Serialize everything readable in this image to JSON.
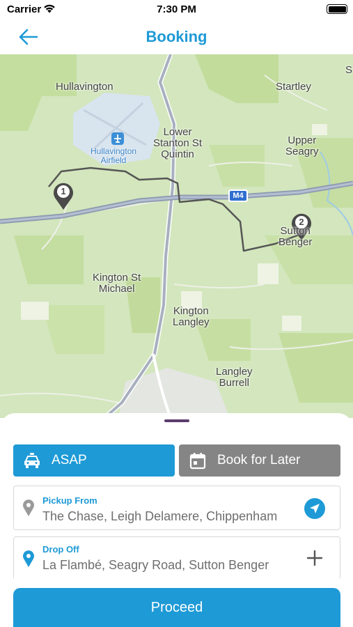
{
  "status_bar": {
    "carrier": "Carrier",
    "time": "7:30 PM"
  },
  "header": {
    "title": "Booking",
    "back_icon": "arrow-left-icon"
  },
  "map": {
    "labels": {
      "hullavington": "Hullavington",
      "startley": "Startley",
      "lower_stanton": "Lower\nStanton St\nQuintin",
      "airfield": "Hullavington\nAirfield",
      "upper_seagry": "Upper\nSeagry",
      "motorway": "M4",
      "sutton_benger": "Sutton\nBenger",
      "kington_st_michael": "Kington St\nMichael",
      "kington_langley": "Kington\nLangley",
      "langley_burrell": "Langley\nBurrell",
      "edge_s": "S"
    },
    "markers": {
      "start": "1",
      "end": "2"
    },
    "colors": {
      "route": "#555555",
      "marker": "#4a4a4a",
      "road": "#9aa5b5"
    }
  },
  "booking": {
    "asap_label": "ASAP",
    "later_label": "Book for Later",
    "pickup": {
      "label": "Pickup From",
      "value": "The Chase, Leigh Delamere, Chippenham"
    },
    "dropoff": {
      "label": "Drop Off",
      "value": "La Flambé, Seagry Road, Sutton Benger"
    },
    "proceed_label": "Proceed"
  },
  "colors": {
    "accent": "#1e9ad6",
    "secondary": "#858585"
  }
}
